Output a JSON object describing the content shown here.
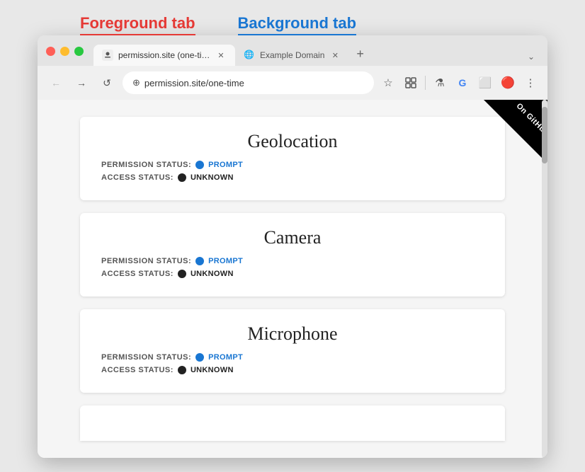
{
  "labels": {
    "foreground": "Foreground tab",
    "background": "Background tab"
  },
  "browser": {
    "tabs": [
      {
        "title": "permission.site (one-time)",
        "url": "permission.site/one-time",
        "active": true,
        "icon": "🔒"
      },
      {
        "title": "Example Domain",
        "url": "https://example.com",
        "active": false,
        "icon": "🌐"
      }
    ],
    "address": "permission.site/one-time"
  },
  "page": {
    "github_label": "On GitHub",
    "cards": [
      {
        "title": "Geolocation",
        "permission_label": "PERMISSION STATUS:",
        "permission_dot": "blue",
        "permission_value": "PROMPT",
        "access_label": "ACCESS STATUS:",
        "access_dot": "black",
        "access_value": "UNKNOWN"
      },
      {
        "title": "Camera",
        "permission_label": "PERMISSION STATUS:",
        "permission_dot": "blue",
        "permission_value": "PROMPT",
        "access_label": "ACCESS STATUS:",
        "access_dot": "black",
        "access_value": "UNKNOWN"
      },
      {
        "title": "Microphone",
        "permission_label": "PERMISSION STATUS:",
        "permission_dot": "blue",
        "permission_value": "PROMPT",
        "access_label": "ACCESS STATUS:",
        "access_dot": "black",
        "access_value": "UNKNOWN"
      }
    ]
  },
  "nav": {
    "back": "←",
    "forward": "→",
    "reload": "↺"
  }
}
